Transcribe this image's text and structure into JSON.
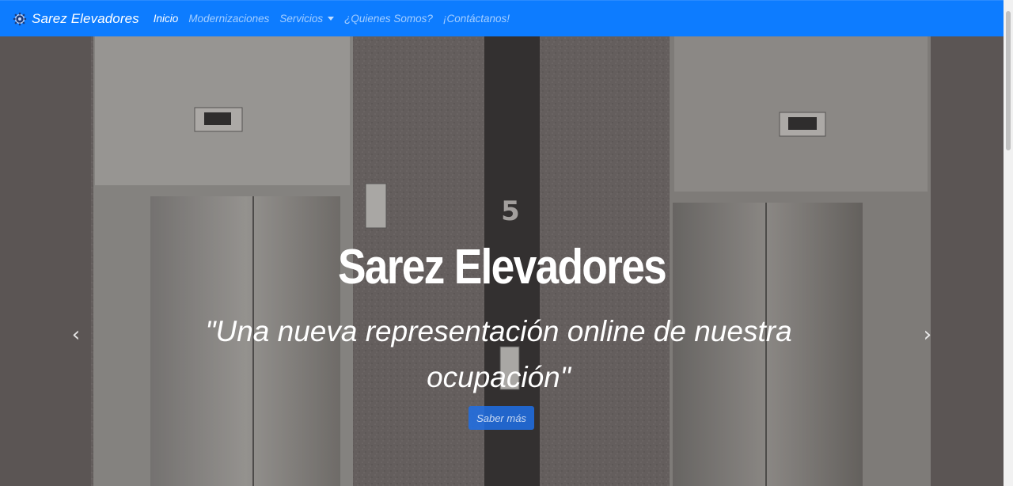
{
  "navbar": {
    "brand": "Sarez Elevadores",
    "links": [
      {
        "label": "Inicio",
        "active": true
      },
      {
        "label": "Modernizaciones"
      },
      {
        "label": "Servicios",
        "dropdown": true
      },
      {
        "label": "¿Quienes Somos?"
      },
      {
        "label": "¡Contáctanos!"
      }
    ],
    "colors": {
      "background": "#0d7cff"
    }
  },
  "hero": {
    "title": "Sarez Elevadores",
    "quote": "\"Una nueva representación online de nuestra ocupación\"",
    "button": "Saber más",
    "floor_number": "5",
    "icons": {
      "prev": "chevron-left-icon",
      "next": "chevron-right-icon"
    }
  }
}
